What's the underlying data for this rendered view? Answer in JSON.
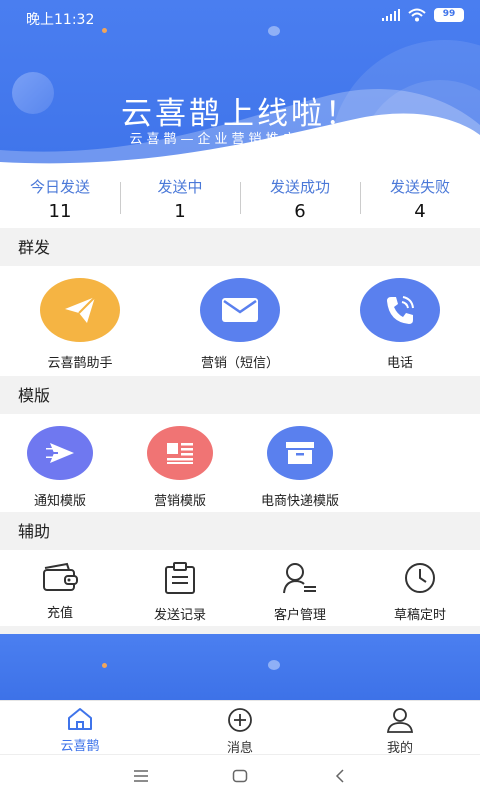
{
  "status_bar": {
    "time": "晚上11:32",
    "battery": "99"
  },
  "banner": {
    "headline": "云喜鹊上线啦！",
    "subline": "云喜鹊—企业营销推广小助手"
  },
  "stats": [
    {
      "label": "今日发送",
      "value": "11"
    },
    {
      "label": "发送中",
      "value": "1"
    },
    {
      "label": "发送成功",
      "value": "6"
    },
    {
      "label": "发送失败",
      "value": "4"
    }
  ],
  "sections": {
    "mass_send": {
      "title": "群发",
      "items": [
        {
          "label": "云喜鹊助手",
          "icon": "paper-plane-icon",
          "color": "#f5b443"
        },
        {
          "label": "营销（短信）",
          "icon": "envelope-icon",
          "color": "#5a80ee"
        },
        {
          "label": "电话",
          "icon": "phone-icon",
          "color": "#5a80ee"
        }
      ]
    },
    "templates": {
      "title": "模版",
      "items": [
        {
          "label": "通知模版",
          "icon": "send-arrow-icon",
          "color": "#6f78f0"
        },
        {
          "label": "营销模版",
          "icon": "newspaper-icon",
          "color": "#f07474"
        },
        {
          "label": "电商快递模版",
          "icon": "archive-box-icon",
          "color": "#5a80ee"
        }
      ]
    },
    "assist": {
      "title": "辅助",
      "items": [
        {
          "label": "充值",
          "icon": "wallet-icon"
        },
        {
          "label": "发送记录",
          "icon": "clipboard-icon"
        },
        {
          "label": "客户管理",
          "icon": "user-list-icon"
        },
        {
          "label": "草稿定时",
          "icon": "clock-icon"
        }
      ]
    }
  },
  "tabbar": [
    {
      "label": "云喜鹊",
      "icon": "home-icon",
      "active": true
    },
    {
      "label": "消息",
      "icon": "plus-circle-icon",
      "active": false
    },
    {
      "label": "我的",
      "icon": "person-icon",
      "active": false
    }
  ],
  "colors": {
    "primary": "#3f74ea",
    "accent_orange": "#f5b443",
    "accent_red": "#f07474"
  }
}
